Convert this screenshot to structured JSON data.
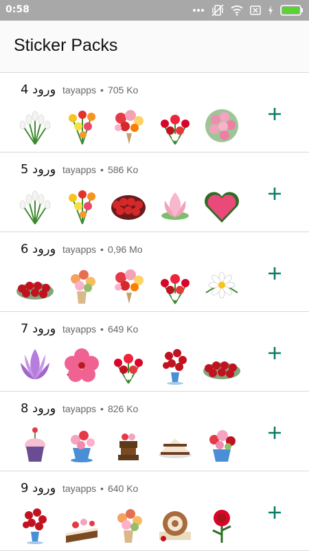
{
  "status_bar": {
    "time": "0:58",
    "icons": [
      "more-dots-icon",
      "vibrate-off-icon",
      "wifi-icon",
      "sim-x-icon",
      "charging-icon",
      "battery-icon"
    ],
    "battery_color": "#5ad232"
  },
  "app_bar": {
    "title": "Sticker Packs"
  },
  "accent_color": "#0a7c68",
  "packs": [
    {
      "name": "ورود 4",
      "publisher": "tayapps",
      "size": "705 Ko",
      "stickers": [
        "white-tulips",
        "mixed-flowers",
        "flower-bouquet",
        "red-flowers-bunch",
        "pink-roses-bouquet"
      ]
    },
    {
      "name": "ورود 5",
      "publisher": "tayapps",
      "size": "586 Ko",
      "stickers": [
        "white-tulips",
        "mixed-flowers",
        "red-rose-basket",
        "pink-lotus",
        "pink-rose-heart"
      ]
    },
    {
      "name": "ورود 6",
      "publisher": "tayapps",
      "size": "0,96 Mo",
      "stickers": [
        "red-rose-pile",
        "flower-vase",
        "flower-bouquet",
        "red-flowers-bunch",
        "white-daisy"
      ]
    },
    {
      "name": "ورود 7",
      "publisher": "tayapps",
      "size": "649 Ko",
      "stickers": [
        "purple-lotus",
        "pink-hibiscus",
        "red-flowers-bunch",
        "rose-vase",
        "red-rose-pile"
      ]
    },
    {
      "name": "ورود 8",
      "publisher": "tayapps",
      "size": "826 Ko",
      "stickers": [
        "cupcake",
        "flower-teacup",
        "chocolate-cake",
        "cake-slice",
        "flower-cup"
      ]
    },
    {
      "name": "ورود 9",
      "publisher": "tayapps",
      "size": "640 Ko",
      "stickers": [
        "rose-vase",
        "layer-cake",
        "flower-vase",
        "roll-cake",
        "red-rose"
      ]
    }
  ]
}
